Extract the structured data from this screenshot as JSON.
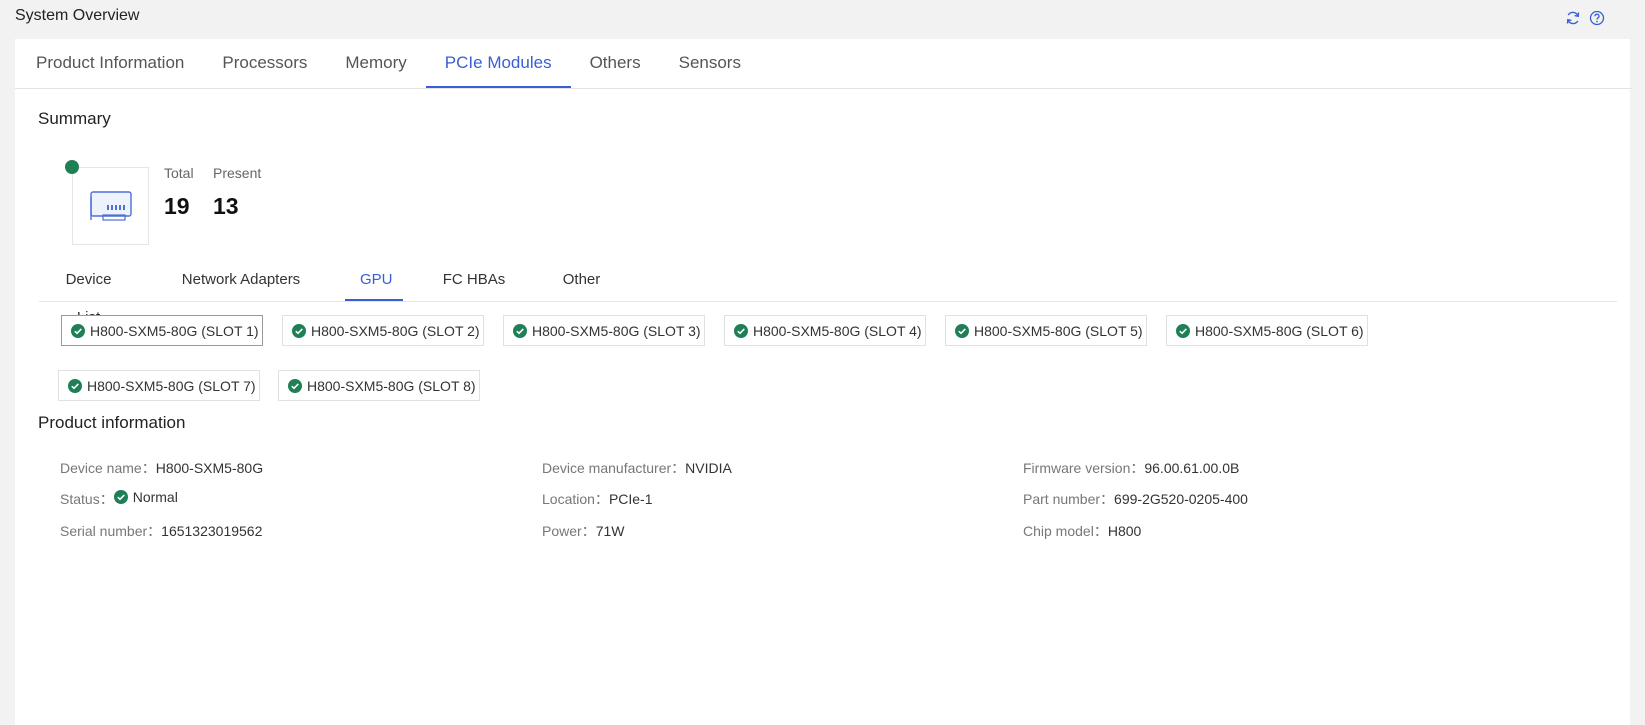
{
  "page": {
    "title": "System Overview"
  },
  "main_tabs": [
    {
      "label": "Product Information"
    },
    {
      "label": "Processors"
    },
    {
      "label": "Memory"
    },
    {
      "label": "PCIe Modules"
    },
    {
      "label": "Others"
    },
    {
      "label": "Sensors"
    }
  ],
  "main_tabs_active": "PCIe Modules",
  "summary": {
    "title": "Summary",
    "total_label": "Total",
    "total_value": "19",
    "present_label": "Present",
    "present_value": "13"
  },
  "sub_tabs": [
    {
      "label": "Device List"
    },
    {
      "label": "Network Adapters"
    },
    {
      "label": "GPU"
    },
    {
      "label": "FC HBAs"
    },
    {
      "label": "Other"
    }
  ],
  "sub_tabs_active": "GPU",
  "gpus": [
    {
      "label": "H800-SXM5-80G (SLOT 1)"
    },
    {
      "label": "H800-SXM5-80G (SLOT 2)"
    },
    {
      "label": "H800-SXM5-80G (SLOT 3)"
    },
    {
      "label": "H800-SXM5-80G (SLOT 4)"
    },
    {
      "label": "H800-SXM5-80G (SLOT 5)"
    },
    {
      "label": "H800-SXM5-80G (SLOT 6)"
    },
    {
      "label": "H800-SXM5-80G (SLOT 7)"
    },
    {
      "label": "H800-SXM5-80G (SLOT 8)"
    }
  ],
  "gpus_selected": "H800-SXM5-80G (SLOT 1)",
  "product_info": {
    "title": "Product information",
    "device_name": {
      "label": "Device name：",
      "value": "H800-SXM5-80G"
    },
    "status": {
      "label": "Status：",
      "value": "Normal"
    },
    "serial_number": {
      "label": "Serial number：",
      "value": "1651323019562"
    },
    "device_manufacturer": {
      "label": "Device manufacturer：",
      "value": "NVIDIA"
    },
    "location": {
      "label": "Location：",
      "value": "PCIe-1"
    },
    "power": {
      "label": "Power：",
      "value": "71W"
    },
    "firmware_version": {
      "label": "Firmware version：",
      "value": "96.00.61.00.0B"
    },
    "part_number": {
      "label": "Part number：",
      "value": "699-2G520-0205-400"
    },
    "chip_model": {
      "label": "Chip model：",
      "value": "H800"
    }
  },
  "colors": {
    "accent": "#3a5ed4",
    "status_ok": "#1f7f55",
    "background": "#f2f2f2"
  },
  "icons": {
    "refresh": "refresh-icon",
    "help": "help-icon",
    "pcie_card": "pcie-card-icon",
    "ok": "check-circle-icon"
  }
}
